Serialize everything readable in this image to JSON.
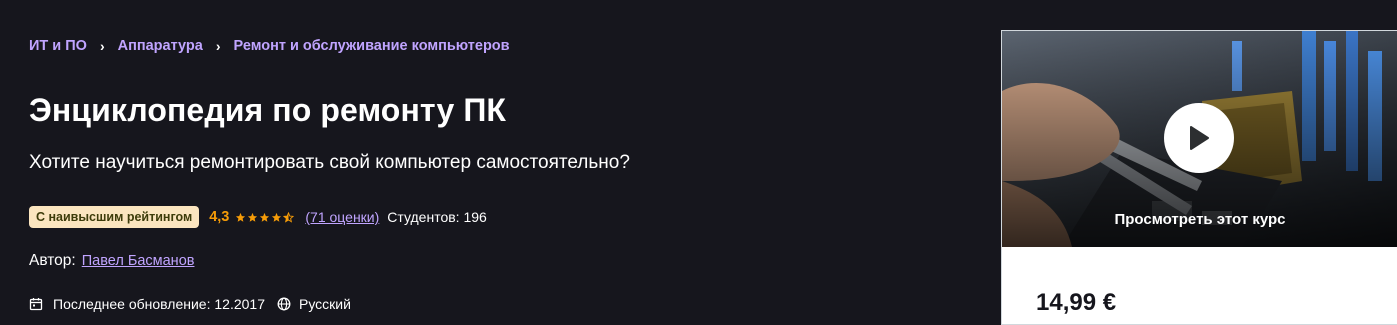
{
  "breadcrumb": [
    {
      "label": "ИТ и ПО"
    },
    {
      "label": "Аппаратура"
    },
    {
      "label": "Ремонт и обслуживание компьютеров"
    }
  ],
  "course": {
    "title": "Энциклопедия по ремонту ПК",
    "subtitle": "Хотите научиться ремонтировать свой компьютер самостоятельно?",
    "badge": "С наивысшим рейтингом",
    "rating": "4,3",
    "stars_value": 4.3,
    "ratings_count": "(71 оценки)",
    "students": "Студентов: 196",
    "author_label": "Автор:",
    "author_name": "Павел Басманов",
    "last_update": "Последнее обновление: 12.2017",
    "language": "Русский"
  },
  "card": {
    "preview_label": "Просмотреть этот курс",
    "price": "14,99 €"
  },
  "colors": {
    "background": "#16161d",
    "link": "#c0a4ff",
    "rating": "#f69c08",
    "badge_bg": "#fbe5bf"
  }
}
